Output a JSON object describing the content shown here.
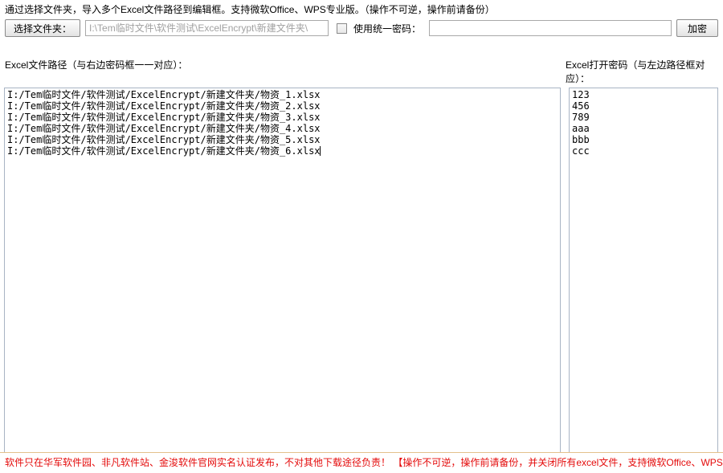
{
  "top_description": "通过选择文件夹，导入多个Excel文件路径到编辑框。支持微软Office、WPS专业版。（操作不可逆，操作前请备份）",
  "toolbar": {
    "select_folder_label": "选择文件夹：",
    "folder_path": "I:\\Tem临时文件\\软件测试\\ExcelEncrypt\\新建文件夹\\",
    "use_unified_password_label": "使用统一密码：",
    "unified_password_value": "",
    "encrypt_label": "加密"
  },
  "labels": {
    "left_label": "Excel文件路径（与右边密码框一一对应）：",
    "right_label": "Excel打开密码（与左边路径框对应）："
  },
  "file_paths": [
    "I:/Tem临时文件/软件测试/ExcelEncrypt/新建文件夹/物资_1.xlsx",
    "I:/Tem临时文件/软件测试/ExcelEncrypt/新建文件夹/物资_2.xlsx",
    "I:/Tem临时文件/软件测试/ExcelEncrypt/新建文件夹/物资_3.xlsx",
    "I:/Tem临时文件/软件测试/ExcelEncrypt/新建文件夹/物资_4.xlsx",
    "I:/Tem临时文件/软件测试/ExcelEncrypt/新建文件夹/物资_5.xlsx",
    "I:/Tem临时文件/软件测试/ExcelEncrypt/新建文件夹/物资_6.xlsx"
  ],
  "passwords": [
    "123",
    "456",
    "789",
    "aaa",
    "bbb",
    "ccc"
  ],
  "footer_text": "软件只在华军软件园、非凡软件站、金浚软件官网实名认证发布，不对其他下载途径负责！ 【操作不可逆，操作前请备份，并关闭所有excel文件，支持微软Office、WPS专业版"
}
